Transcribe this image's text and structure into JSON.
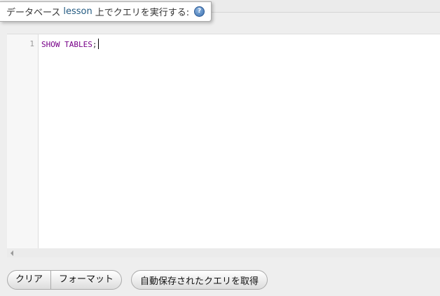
{
  "legend": {
    "prefix": "データベース",
    "database": "lesson",
    "suffix": "上でクエリを実行する:",
    "help_icon": "help-icon"
  },
  "editor": {
    "line_numbers": [
      "1"
    ],
    "query": {
      "keyword1": "SHOW",
      "space": " ",
      "keyword2": "TABLES",
      "terminator": ";"
    }
  },
  "buttons": {
    "clear": "クリア",
    "format": "フォーマット",
    "get_autosaved": "自動保存されたクエリを取得"
  },
  "colors": {
    "database_link": "#235a81",
    "sql_keyword": "#770088"
  }
}
